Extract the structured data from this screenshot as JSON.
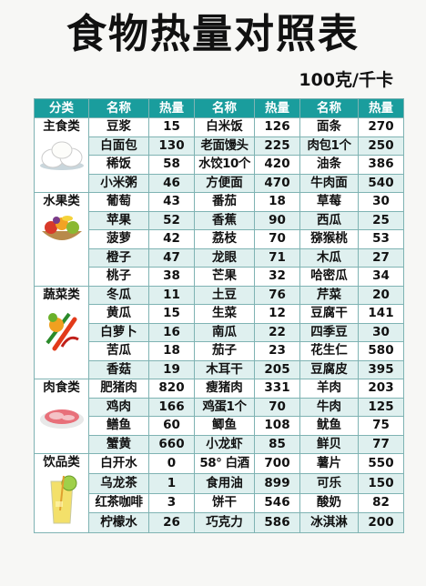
{
  "title": "食物热量对照表",
  "unit": "100克/千卡",
  "headers": [
    "分类",
    "名称",
    "热量",
    "名称",
    "热量",
    "名称",
    "热量"
  ],
  "categories": [
    {
      "name": "主食类",
      "icon": "steamed-bun-icon",
      "rows": [
        [
          [
            "豆浆",
            "15"
          ],
          [
            "白米饭",
            "126"
          ],
          [
            "面条",
            "270"
          ]
        ],
        [
          [
            "白面包",
            "130"
          ],
          [
            "老面馒头",
            "225"
          ],
          [
            "肉包1个",
            "250"
          ]
        ],
        [
          [
            "稀饭",
            "58"
          ],
          [
            "水饺10个",
            "420"
          ],
          [
            "油条",
            "386"
          ]
        ],
        [
          [
            "小米粥",
            "46"
          ],
          [
            "方便面",
            "470"
          ],
          [
            "牛肉面",
            "540"
          ]
        ]
      ]
    },
    {
      "name": "水果类",
      "icon": "fruit-basket-icon",
      "rows": [
        [
          [
            "葡萄",
            "43"
          ],
          [
            "番茄",
            "18"
          ],
          [
            "草莓",
            "30"
          ]
        ],
        [
          [
            "苹果",
            "52"
          ],
          [
            "香蕉",
            "90"
          ],
          [
            "西瓜",
            "25"
          ]
        ],
        [
          [
            "菠萝",
            "42"
          ],
          [
            "荔枝",
            "70"
          ],
          [
            "猕猴桃",
            "53"
          ]
        ],
        [
          [
            "橙子",
            "47"
          ],
          [
            "龙眼",
            "71"
          ],
          [
            "木瓜",
            "27"
          ]
        ],
        [
          [
            "桃子",
            "38"
          ],
          [
            "芒果",
            "32"
          ],
          [
            "哈密瓜",
            "34"
          ]
        ]
      ]
    },
    {
      "name": "蔬菜类",
      "icon": "vegetables-icon",
      "rows": [
        [
          [
            "冬瓜",
            "11"
          ],
          [
            "土豆",
            "76"
          ],
          [
            "芹菜",
            "20"
          ]
        ],
        [
          [
            "黄瓜",
            "15"
          ],
          [
            "生菜",
            "12"
          ],
          [
            "豆腐干",
            "141"
          ]
        ],
        [
          [
            "白萝卜",
            "16"
          ],
          [
            "南瓜",
            "22"
          ],
          [
            "四季豆",
            "30"
          ]
        ],
        [
          [
            "苦瓜",
            "18"
          ],
          [
            "茄子",
            "23"
          ],
          [
            "花生仁",
            "580"
          ]
        ],
        [
          [
            "香菇",
            "19"
          ],
          [
            "木耳干",
            "205"
          ],
          [
            "豆腐皮",
            "395"
          ]
        ]
      ]
    },
    {
      "name": "肉食类",
      "icon": "meat-platter-icon",
      "rows": [
        [
          [
            "肥猪肉",
            "820"
          ],
          [
            "瘦猪肉",
            "331"
          ],
          [
            "羊肉",
            "203"
          ]
        ],
        [
          [
            "鸡肉",
            "166"
          ],
          [
            "鸡蛋1个",
            "70"
          ],
          [
            "牛肉",
            "125"
          ]
        ],
        [
          [
            "鳝鱼",
            "60"
          ],
          [
            "鲫鱼",
            "108"
          ],
          [
            "鱿鱼",
            "75"
          ]
        ],
        [
          [
            "蟹黄",
            "660"
          ],
          [
            "小龙虾",
            "85"
          ],
          [
            "鲜贝",
            "77"
          ]
        ]
      ]
    },
    {
      "name": "饮品类",
      "icon": "juice-glass-icon",
      "rows": [
        [
          [
            "白开水",
            "0"
          ],
          [
            "58° 白酒",
            "700"
          ],
          [
            "薯片",
            "550"
          ]
        ],
        [
          [
            "乌龙茶",
            "1"
          ],
          [
            "食用油",
            "899"
          ],
          [
            "可乐",
            "150"
          ]
        ],
        [
          [
            "红茶咖啡",
            "3"
          ],
          [
            "饼干",
            "546"
          ],
          [
            "酸奶",
            "82"
          ]
        ],
        [
          [
            "柠檬水",
            "26"
          ],
          [
            "巧克力",
            "586"
          ],
          [
            "冰淇淋",
            "200"
          ]
        ]
      ]
    }
  ]
}
